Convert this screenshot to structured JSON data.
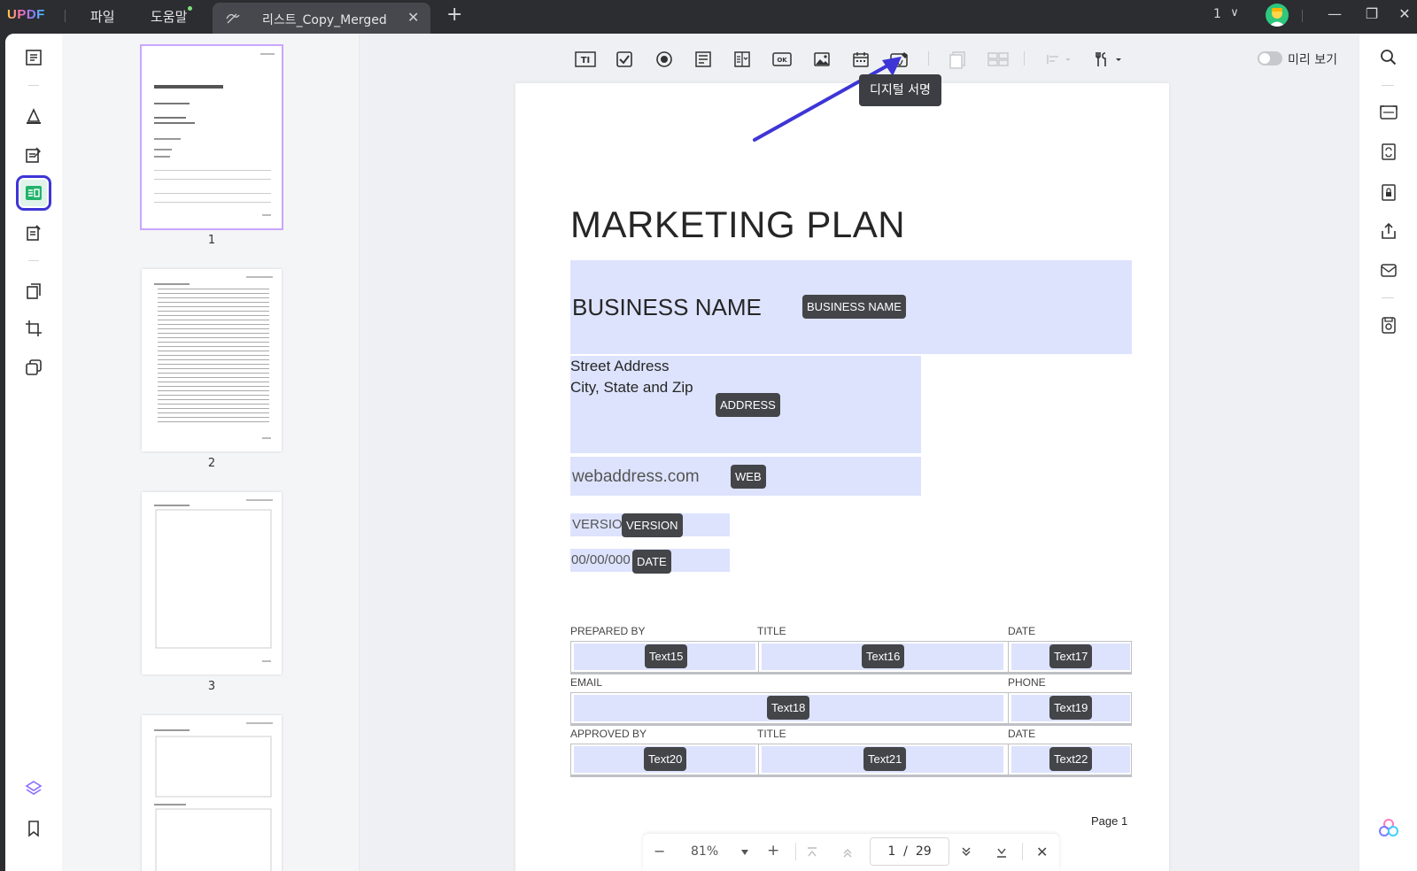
{
  "titlebar": {
    "logo": "UPDF",
    "menu_file": "파일",
    "menu_help": "도움말",
    "tab_title": "리스트_Copy_Merged",
    "tab_close": "✕",
    "tab_add": "+",
    "page_count": "1",
    "chevron": "∨",
    "minimize": "—",
    "restore": "❐",
    "close": "✕"
  },
  "toolbar": {
    "icons": [
      "text-field-icon",
      "checkbox-icon",
      "radio-button-icon",
      "list-box-icon",
      "dropdown-icon",
      "button-icon",
      "image-field-icon",
      "date-field-icon",
      "digital-signature-icon",
      "duplicate-field-icon",
      "grid-icon",
      "align-icon",
      "tools-icon"
    ],
    "text_field_glyph": "TI",
    "button_glyph": "OK",
    "preview_label": "미리 보기",
    "tooltip": "디지털 서명"
  },
  "thumbnails": [
    {
      "number": "1",
      "selected": true
    },
    {
      "number": "2",
      "selected": false
    },
    {
      "number": "3",
      "selected": false
    }
  ],
  "page": {
    "title": "MARKETING PLAN",
    "business_name": "BUSINESS NAME",
    "business_name_tag": "BUSINESS NAME",
    "street": "Street Address",
    "city": "City, State and Zip",
    "address_tag": "ADDRESS",
    "web": "webaddress.com",
    "web_tag": "WEB",
    "version": "VERSION",
    "version_tag": "VERSION",
    "date_value": "00/00/000",
    "date_tag": "DATE",
    "labels": {
      "prepared_by": "PREPARED BY",
      "title1": "TITLE",
      "date1": "DATE",
      "email": "EMAIL",
      "phone": "PHONE",
      "approved_by": "APPROVED BY",
      "title2": "TITLE",
      "date2": "DATE"
    },
    "fields": [
      "Text15",
      "Text16",
      "Text17",
      "Text18",
      "Text19",
      "Text20",
      "Text21",
      "Text22"
    ],
    "footer": "Page 1"
  },
  "zoom_bar": {
    "minus": "−",
    "zoom": "81%",
    "plus": "+",
    "current_page": "1",
    "total_pages": "29",
    "close": "✕"
  },
  "colors": {
    "accent": "#3d35d6",
    "field_fill": "#dde3fd",
    "tag_fill": "#434549",
    "annotation_arrow": "#3d35d6"
  }
}
